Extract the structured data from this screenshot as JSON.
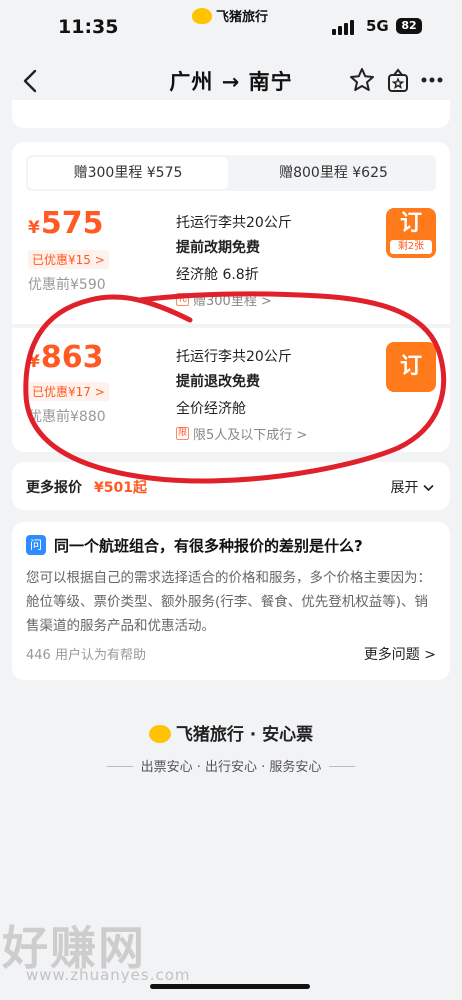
{
  "status_bar": {
    "time": "11:35",
    "brand": "飞猪旅行",
    "network": "5G",
    "battery": "82"
  },
  "nav": {
    "title": "广州 → 南宁"
  },
  "tabs": [
    {
      "label": "赠300里程 ¥575",
      "active": true
    },
    {
      "label": "赠800里程 ¥625",
      "active": false
    }
  ],
  "offers": [
    {
      "currency": "¥",
      "price": "575",
      "discount": "已优惠¥15 >",
      "original": "优惠前¥590",
      "lines": [
        "托运行李共20公斤",
        "提前改期免费",
        "经济舱 6.8折"
      ],
      "tag_mark": "礼",
      "tag": "赠300里程 >",
      "book_label": "订",
      "remaining": "剩2张"
    },
    {
      "currency": "¥",
      "price": "863",
      "discount": "已优惠¥17 >",
      "original": "优惠前¥880",
      "lines": [
        "托运行李共20公斤",
        "提前退改免费",
        "全价经济舱"
      ],
      "tag_mark": "限",
      "tag": "限5人及以下成行 >",
      "book_label": "订"
    }
  ],
  "more_quotes": {
    "label": "更多报价",
    "price": "¥501起",
    "expand": "展开"
  },
  "qa": {
    "icon_text": "问",
    "title": "同一个航班组合，有很多种报价的差别是什么?",
    "body": "您可以根据自己的需求选择适合的价格和服务，多个价格主要因为：舱位等级、票价类型、额外服务(行李、餐食、优先登机权益等)、销售渠道的服务产品和优惠活动。",
    "helpful": "446 用户认为有帮助",
    "more": "更多问题 >"
  },
  "footer": {
    "brand": "飞猪旅行 · 安心票",
    "tagline": "出票安心 · 出行安心 · 服务安心"
  },
  "watermark": {
    "text": "好赚网",
    "url": "www.zhuanyes.com"
  },
  "colors": {
    "accent": "#ff5a23",
    "button": "#ff7a1a",
    "annotation": "#e0202a"
  }
}
